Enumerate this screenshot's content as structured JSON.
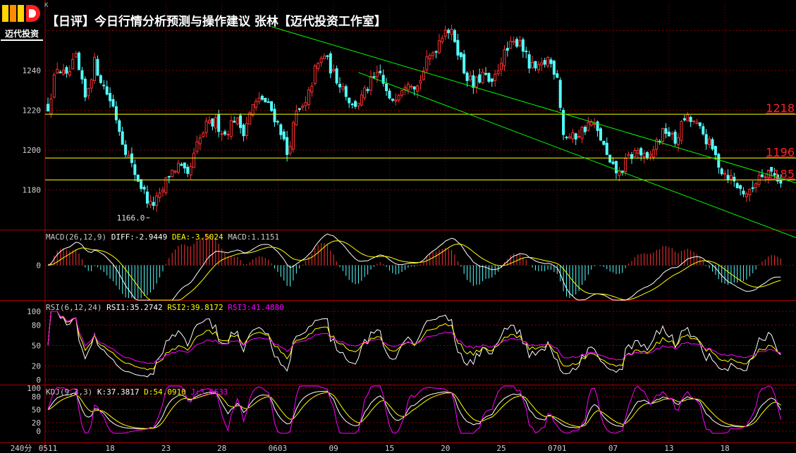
{
  "title": "【日评】今日行情分析预测与操作建议  张林【迈代投资工作室】",
  "logo": {
    "mark": "MD",
    "text": "迈代投资"
  },
  "k_label": "K",
  "period_label": "240分",
  "colors": {
    "up": "#ff3232",
    "down": "#54ffff",
    "grid": "#8b0000",
    "level": "#ffff00",
    "channel": "#00ff00",
    "white": "#ffffff",
    "magenta": "#ff00ff"
  },
  "price_panel": {
    "y_ticks": [
      1180,
      1200,
      1220,
      1240
    ],
    "ylim": [
      1155,
      1260
    ],
    "levels": [
      {
        "value": 1218,
        "label": "1218"
      },
      {
        "value": 1196,
        "label": "1196"
      },
      {
        "value": 1185,
        "label": "1185"
      }
    ],
    "low_marker": {
      "index": 33,
      "value": 1166.0,
      "label": "1166.0"
    }
  },
  "x_ticks": [
    {
      "index": 0,
      "label": "0511"
    },
    {
      "index": 20,
      "label": "18"
    },
    {
      "index": 38,
      "label": "23"
    },
    {
      "index": 56,
      "label": "28"
    },
    {
      "index": 74,
      "label": "0603"
    },
    {
      "index": 92,
      "label": "09"
    },
    {
      "index": 110,
      "label": "15"
    },
    {
      "index": 128,
      "label": "20"
    },
    {
      "index": 146,
      "label": "25"
    },
    {
      "index": 164,
      "label": "0701"
    },
    {
      "index": 182,
      "label": "07"
    },
    {
      "index": 200,
      "label": "13"
    },
    {
      "index": 218,
      "label": "18"
    }
  ],
  "chart_data": [
    {
      "type": "candlestick",
      "series": [
        {
          "name": "K",
          "anchors": [
            {
              "i": 0,
              "v": 1222
            },
            {
              "i": 3,
              "v": 1242
            },
            {
              "i": 6,
              "v": 1236
            },
            {
              "i": 9,
              "v": 1246
            },
            {
              "i": 12,
              "v": 1226
            },
            {
              "i": 15,
              "v": 1244
            },
            {
              "i": 18,
              "v": 1232
            },
            {
              "i": 21,
              "v": 1222
            },
            {
              "i": 24,
              "v": 1205
            },
            {
              "i": 27,
              "v": 1192
            },
            {
              "i": 30,
              "v": 1182
            },
            {
              "i": 33,
              "v": 1172
            },
            {
              "i": 36,
              "v": 1176
            },
            {
              "i": 39,
              "v": 1188
            },
            {
              "i": 42,
              "v": 1192
            },
            {
              "i": 45,
              "v": 1186
            },
            {
              "i": 48,
              "v": 1202
            },
            {
              "i": 51,
              "v": 1212
            },
            {
              "i": 54,
              "v": 1214
            },
            {
              "i": 57,
              "v": 1208
            },
            {
              "i": 60,
              "v": 1216
            },
            {
              "i": 63,
              "v": 1210
            },
            {
              "i": 66,
              "v": 1222
            },
            {
              "i": 69,
              "v": 1226
            },
            {
              "i": 72,
              "v": 1220
            },
            {
              "i": 75,
              "v": 1210
            },
            {
              "i": 77,
              "v": 1198
            },
            {
              "i": 80,
              "v": 1218
            },
            {
              "i": 83,
              "v": 1222
            },
            {
              "i": 86,
              "v": 1240
            },
            {
              "i": 89,
              "v": 1248
            },
            {
              "i": 92,
              "v": 1238
            },
            {
              "i": 95,
              "v": 1232
            },
            {
              "i": 98,
              "v": 1222
            },
            {
              "i": 101,
              "v": 1226
            },
            {
              "i": 104,
              "v": 1234
            },
            {
              "i": 107,
              "v": 1238
            },
            {
              "i": 110,
              "v": 1224
            },
            {
              "i": 113,
              "v": 1230
            },
            {
              "i": 116,
              "v": 1236
            },
            {
              "i": 119,
              "v": 1232
            },
            {
              "i": 122,
              "v": 1244
            },
            {
              "i": 125,
              "v": 1252
            },
            {
              "i": 128,
              "v": 1262
            },
            {
              "i": 131,
              "v": 1256
            },
            {
              "i": 134,
              "v": 1240
            },
            {
              "i": 137,
              "v": 1232
            },
            {
              "i": 140,
              "v": 1238
            },
            {
              "i": 143,
              "v": 1232
            },
            {
              "i": 146,
              "v": 1246
            },
            {
              "i": 149,
              "v": 1252
            },
            {
              "i": 152,
              "v": 1256
            },
            {
              "i": 155,
              "v": 1242
            },
            {
              "i": 158,
              "v": 1240
            },
            {
              "i": 161,
              "v": 1246
            },
            {
              "i": 164,
              "v": 1238
            },
            {
              "i": 166,
              "v": 1208
            },
            {
              "i": 169,
              "v": 1206
            },
            {
              "i": 172,
              "v": 1210
            },
            {
              "i": 175,
              "v": 1214
            },
            {
              "i": 178,
              "v": 1206
            },
            {
              "i": 181,
              "v": 1192
            },
            {
              "i": 184,
              "v": 1188
            },
            {
              "i": 187,
              "v": 1196
            },
            {
              "i": 190,
              "v": 1200
            },
            {
              "i": 193,
              "v": 1194
            },
            {
              "i": 196,
              "v": 1204
            },
            {
              "i": 199,
              "v": 1210
            },
            {
              "i": 202,
              "v": 1204
            },
            {
              "i": 205,
              "v": 1216
            },
            {
              "i": 208,
              "v": 1214
            },
            {
              "i": 211,
              "v": 1208
            },
            {
              "i": 214,
              "v": 1200
            },
            {
              "i": 217,
              "v": 1190
            },
            {
              "i": 220,
              "v": 1186
            },
            {
              "i": 223,
              "v": 1180
            },
            {
              "i": 226,
              "v": 1178
            },
            {
              "i": 229,
              "v": 1188
            },
            {
              "i": 232,
              "v": 1190
            },
            {
              "i": 235,
              "v": 1186
            },
            {
              "i": 236,
              "v": 1185
            }
          ]
        }
      ],
      "ylim": [
        1155,
        1260
      ]
    },
    {
      "type": "line",
      "name": "MACD",
      "params": "MACD(26,12,9)",
      "readouts": [
        {
          "name": "DIFF",
          "text": "DIFF:-2.9449",
          "color": "#ffffff"
        },
        {
          "name": "DEA",
          "text": "DEA:-3.5024",
          "color": "#ffff00"
        },
        {
          "name": "MACD",
          "text": "MACD:1.1151",
          "color": "#cccccc"
        }
      ],
      "y_ticks": [
        0
      ],
      "ylim": [
        -10,
        10
      ]
    },
    {
      "type": "line",
      "name": "RSI",
      "params": "RSI(6,12,24)",
      "readouts": [
        {
          "name": "RSI1",
          "text": "RSI1:35.2742",
          "color": "#ffffff"
        },
        {
          "name": "RSI2",
          "text": "RSI2:39.8172",
          "color": "#ffff00"
        },
        {
          "name": "RSI3",
          "text": "RSI3:41.4880",
          "color": "#ff00ff"
        }
      ],
      "y_ticks": [
        100,
        80,
        50,
        20,
        0
      ],
      "ylim": [
        0,
        100
      ]
    },
    {
      "type": "line",
      "name": "KDJ",
      "params": "KDJ(9,3,3)",
      "readouts": [
        {
          "name": "K",
          "text": "K:37.3817",
          "color": "#ffffff"
        },
        {
          "name": "D",
          "text": "D:54.0910",
          "color": "#ffff00"
        },
        {
          "name": "J",
          "text": "J:3.9633",
          "color": "#ff00ff"
        }
      ],
      "y_ticks": [
        100,
        80,
        50,
        20,
        0
      ],
      "ylim": [
        -5,
        105
      ]
    }
  ]
}
